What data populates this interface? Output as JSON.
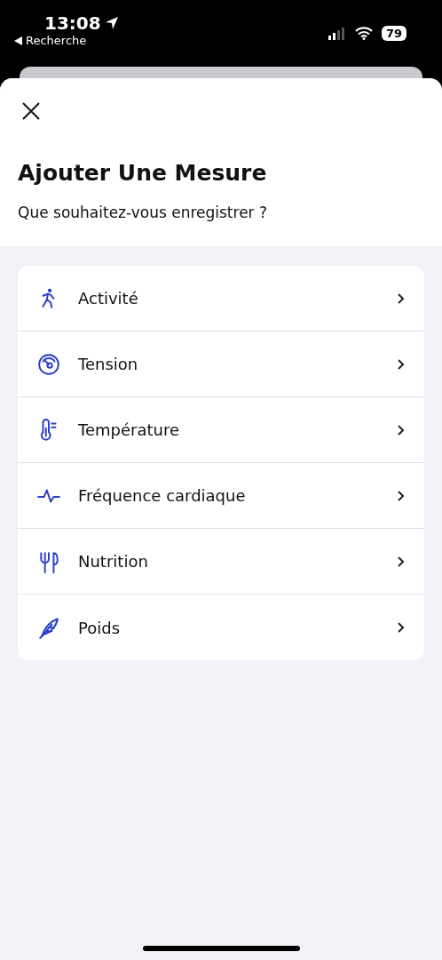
{
  "status_bar": {
    "time": "13:08",
    "back_label": "Recherche",
    "battery": "79"
  },
  "sheet": {
    "title": "Ajouter Une Mesure",
    "subtitle": "Que souhaitez-vous enregistrer ?"
  },
  "items": [
    {
      "kind": "activity",
      "label": "Activité"
    },
    {
      "kind": "gauge",
      "label": "Tension"
    },
    {
      "kind": "thermometer",
      "label": "Température"
    },
    {
      "kind": "pulse",
      "label": "Fréquence cardiaque"
    },
    {
      "kind": "fork",
      "label": "Nutrition"
    },
    {
      "kind": "feather",
      "label": "Poids"
    }
  ]
}
